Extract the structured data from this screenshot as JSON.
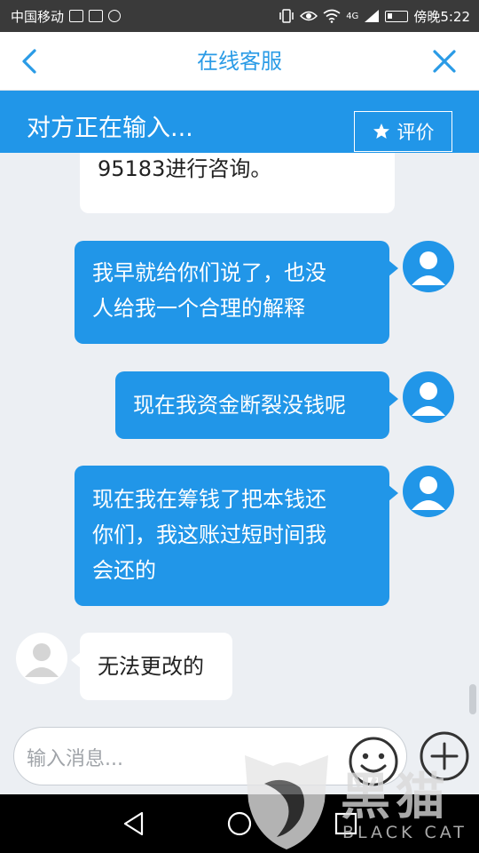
{
  "status_bar": {
    "carrier": "中国移动",
    "time": "傍晚5:22",
    "network": "4G"
  },
  "header": {
    "title": "在线客服",
    "back_icon": "chevron-left-icon",
    "close_icon": "close-icon"
  },
  "banner": {
    "typing_text": "对方正在输入...",
    "rate_label": "评价",
    "rate_icon": "star-icon"
  },
  "messages": [
    {
      "sender": "agent",
      "text_lines": [
        "95183进行咨询。"
      ]
    },
    {
      "sender": "user",
      "text_lines": [
        "我早就给你们说了，也没",
        "人给我一个合理的解释"
      ]
    },
    {
      "sender": "user",
      "text_lines": [
        "现在我资金断裂没钱呢"
      ]
    },
    {
      "sender": "user",
      "text_lines": [
        "现在我在筹钱了把本钱还",
        "你们，我这账过短时间我",
        "会还的"
      ]
    },
    {
      "sender": "agent",
      "text_lines": [
        "无法更改的"
      ]
    }
  ],
  "input": {
    "placeholder": "输入消息..."
  },
  "watermark": {
    "text": "黑猫",
    "subtext": "BLACK CAT"
  },
  "colors": {
    "accent": "#2196e8",
    "title": "#2a9be6",
    "background": "#eceff3"
  }
}
